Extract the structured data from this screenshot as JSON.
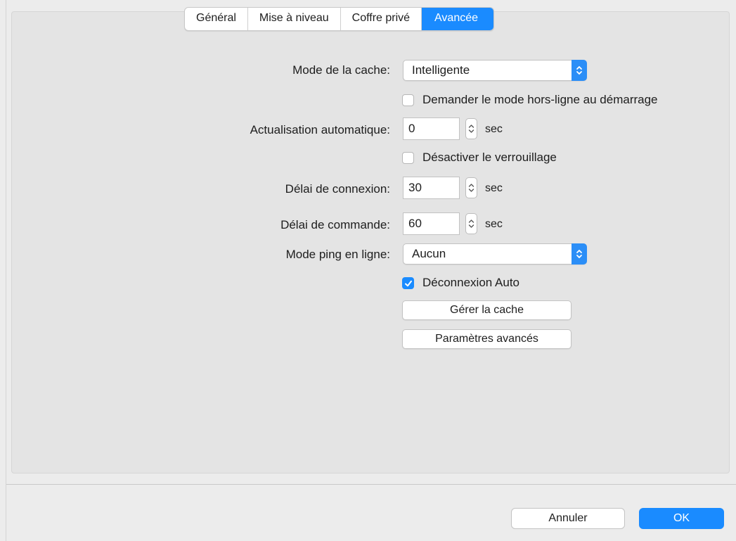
{
  "tabs": [
    {
      "label": "Général",
      "active": false
    },
    {
      "label": "Mise à niveau",
      "active": false
    },
    {
      "label": "Coffre privé",
      "active": false
    },
    {
      "label": "Avancée",
      "active": true
    }
  ],
  "form": {
    "cache_mode": {
      "label": "Mode de la cache:",
      "value": "Intelligente"
    },
    "offline_prompt": {
      "label": "Demander le mode hors-ligne au démarrage",
      "checked": false
    },
    "auto_refresh": {
      "label": "Actualisation automatique:",
      "value": "0",
      "unit": "sec"
    },
    "disable_locking": {
      "label": "Désactiver le verrouillage",
      "checked": false
    },
    "connection_timeout": {
      "label": "Délai de connexion:",
      "value": "30",
      "unit": "sec"
    },
    "command_timeout": {
      "label": "Délai de commande:",
      "value": "60",
      "unit": "sec"
    },
    "ping_mode": {
      "label": "Mode ping en ligne:",
      "value": "Aucun"
    },
    "auto_disconnect": {
      "label": "Déconnexion Auto",
      "checked": true
    },
    "manage_cache_label": "Gérer la cache",
    "advanced_settings_label": "Paramètres avancés"
  },
  "footer": {
    "cancel_label": "Annuler",
    "ok_label": "OK"
  },
  "colors": {
    "accent": "#1a8bff",
    "panel": "#e4e4e4",
    "window": "#ececec"
  },
  "icons": {
    "popup_arrows": "chevron-up-down-icon",
    "stepper": "stepper-arrows-icon",
    "check": "checkmark-icon"
  }
}
